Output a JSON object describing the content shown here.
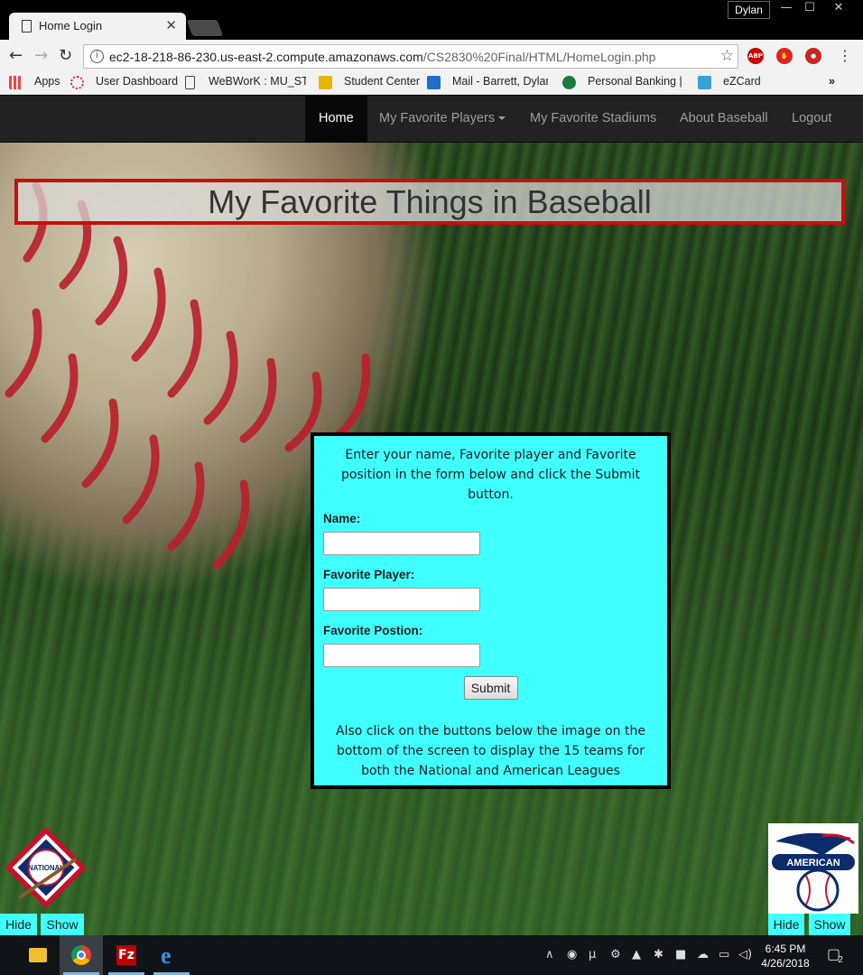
{
  "browser": {
    "tab_title": "Home Login",
    "profile_name": "Dylan",
    "url_host": "ec2-18-218-86-230.us-east-2.compute.amazonaws.com",
    "url_path": "/CS2830%20Final/HTML/HomeLogin.php",
    "extensions": [
      "ABP",
      "ublock-icon",
      "ghost-icon"
    ]
  },
  "bookmarks": [
    {
      "label": "Apps",
      "icon": "apps-grid-icon"
    },
    {
      "label": "User Dashboard",
      "icon": "dashboard-icon"
    },
    {
      "label": "WeBWorK : MU_STAT",
      "icon": "page-icon"
    },
    {
      "label": "Student Center",
      "icon": "mizzou-icon"
    },
    {
      "label": "Mail - Barrett, Dylan",
      "icon": "outlook-icon"
    },
    {
      "label": "Personal Banking | C",
      "icon": "bank-icon"
    },
    {
      "label": "eZCard",
      "icon": "ezcard-icon"
    }
  ],
  "navbar": {
    "home": "Home",
    "players": "My Favorite Players",
    "stadiums": "My Favorite Stadiums",
    "about": "About Baseball",
    "logout": "Logout"
  },
  "banner_title": "My Favorite Things in Baseball",
  "form": {
    "intro": "Enter your name, Favorite player and Favorite position in the form below and click the Submit button.",
    "name_label": "Name:",
    "name_value": "",
    "player_label": "Favorite Player:",
    "player_value": "",
    "position_label": "Favorite Postion:",
    "position_value": "",
    "submit_label": "Submit",
    "outro": "Also click on the buttons below the image on the bottom of the screen to display the 15 teams for both the National and American Leagues"
  },
  "leagues": {
    "national_logo_text": "NATIONAL",
    "american_logo_text": "AMERICAN",
    "hide_label": "Hide",
    "show_label": "Show"
  },
  "taskbar": {
    "time": "6:45 PM",
    "date": "4/26/2018",
    "notifications": "2"
  },
  "colors": {
    "form_bg": "#40ffff",
    "banner_border": "#c41010",
    "navbar_bg": "#222222"
  }
}
